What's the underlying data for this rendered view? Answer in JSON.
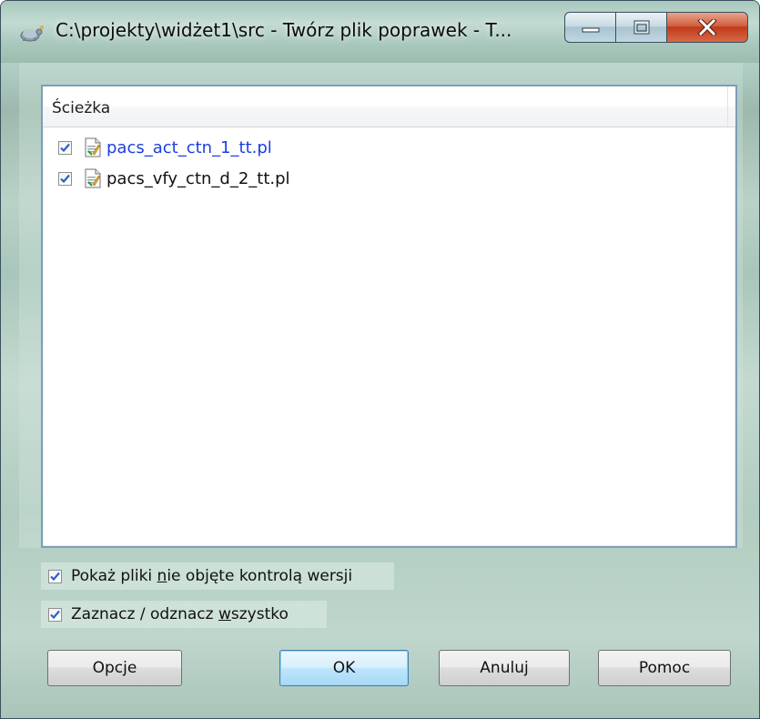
{
  "window": {
    "title": "C:\\projekty\\widżet1\\src - Twórz plik poprawek - T..."
  },
  "list": {
    "column_header": "Ścieżka",
    "files": [
      {
        "name": "pacs_act_ctn_1_tt.pl",
        "checked": true,
        "status": "modified",
        "color": "#1b3fe0"
      },
      {
        "name": "pacs_vfy_ctn_d_2_tt.pl",
        "checked": true,
        "status": "normal",
        "color": "#111111"
      }
    ]
  },
  "options": {
    "show_unversioned": {
      "label_pre": "Pokaż pliki ",
      "label_mnemonic": "n",
      "label_post": "ie objęte kontrolą wersji",
      "checked": true
    },
    "select_all": {
      "label_pre": "Zaznacz / odznacz ",
      "label_mnemonic": "w",
      "label_post": "szystko",
      "checked": true
    }
  },
  "buttons": {
    "options": {
      "label_pre": "Opc",
      "label_mnemonic": "j",
      "label_post": "e"
    },
    "ok": {
      "label": "OK"
    },
    "cancel": {
      "label": "Anuluj"
    },
    "help": {
      "label": "Pomoc"
    }
  },
  "colors": {
    "close_button": "#c0391b",
    "checkbox_check": "#2d5fc7",
    "listview_border": "#7f9db9",
    "default_button_border": "#3c7fb1"
  },
  "icons": {
    "app": "tortoise-icon",
    "minimize": "minimize-icon",
    "maximize": "maximize-icon",
    "close": "close-icon",
    "file": "text-file-icon",
    "checkbox": "checkmark-icon"
  }
}
